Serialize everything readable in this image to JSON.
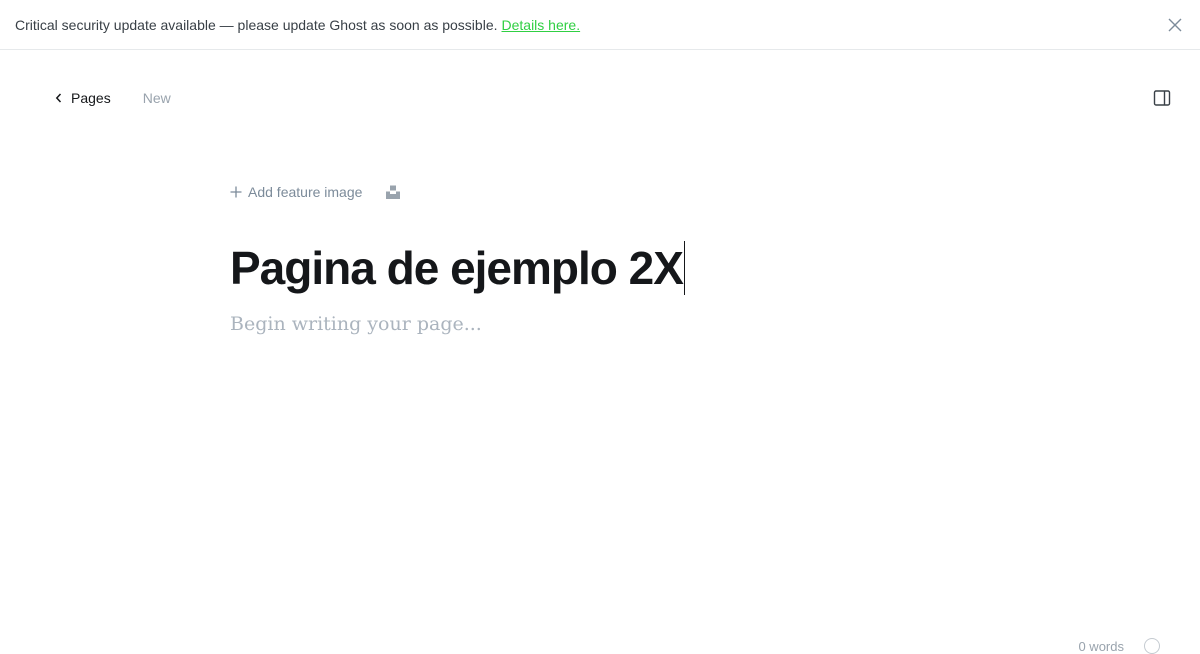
{
  "alert": {
    "message": "Critical security update available — please update Ghost as soon as possible.",
    "link_text": "Details here."
  },
  "header": {
    "back_label": "Pages",
    "status": "New"
  },
  "editor": {
    "add_feature_image_label": "Add feature image",
    "title": "Pagina de ejemplo 2X",
    "body_placeholder": "Begin writing your page..."
  },
  "footer": {
    "word_count_partial": "0 words"
  },
  "colors": {
    "accent": "#30cf43",
    "text": "#15171a",
    "muted": "#99a3ad"
  }
}
